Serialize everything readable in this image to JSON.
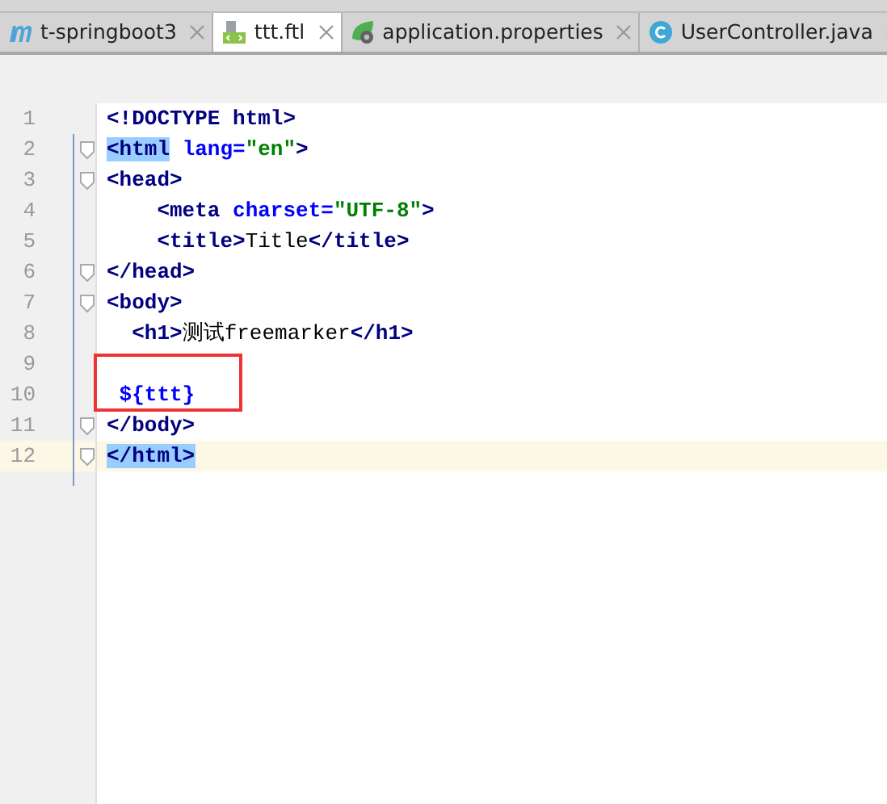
{
  "tabs": [
    {
      "label": "t-springboot3",
      "kind": "maven",
      "selected": false
    },
    {
      "label": "ttt.ftl",
      "kind": "template",
      "selected": true
    },
    {
      "label": "application.properties",
      "kind": "config",
      "selected": false
    },
    {
      "label": "UserController.java",
      "kind": "class",
      "selected": false
    }
  ],
  "editor": {
    "lines": [
      {
        "number": "1",
        "fold": false,
        "current": false,
        "tokens": [
          {
            "kind": "tag",
            "text": "<!DOCTYPE "
          },
          {
            "kind": "keyword",
            "text": "html"
          },
          {
            "kind": "tag",
            "text": ">"
          }
        ]
      },
      {
        "number": "2",
        "fold": true,
        "current": false,
        "tokens": [
          {
            "kind": "tag",
            "text": "<html",
            "matched": true
          },
          {
            "kind": "attr",
            "text": " lang="
          },
          {
            "kind": "str",
            "text": "\"en\""
          },
          {
            "kind": "tag",
            "text": ">"
          }
        ]
      },
      {
        "number": "3",
        "fold": true,
        "current": false,
        "tokens": [
          {
            "kind": "tag",
            "text": "<head>"
          }
        ]
      },
      {
        "number": "4",
        "fold": false,
        "current": false,
        "tokens": [
          {
            "kind": "tag",
            "text": "    <meta "
          },
          {
            "kind": "attr",
            "text": "charset="
          },
          {
            "kind": "str",
            "text": "\"UTF-8\""
          },
          {
            "kind": "tag",
            "text": ">"
          }
        ]
      },
      {
        "number": "5",
        "fold": false,
        "current": false,
        "tokens": [
          {
            "kind": "tag",
            "text": "    <title>"
          },
          {
            "kind": "text",
            "text": "Title"
          },
          {
            "kind": "tag",
            "text": "</title>"
          }
        ]
      },
      {
        "number": "6",
        "fold": true,
        "current": false,
        "tokens": [
          {
            "kind": "tag",
            "text": "</head>"
          }
        ]
      },
      {
        "number": "7",
        "fold": true,
        "current": false,
        "tokens": [
          {
            "kind": "tag",
            "text": "<body>"
          }
        ]
      },
      {
        "number": "8",
        "fold": false,
        "current": false,
        "tokens": [
          {
            "kind": "tag",
            "text": "  <h1>"
          },
          {
            "kind": "text",
            "text": "测试freemarker"
          },
          {
            "kind": "tag",
            "text": "</h1>"
          }
        ]
      },
      {
        "number": "9",
        "fold": false,
        "current": false
      },
      {
        "number": "10",
        "fold": false,
        "current": false,
        "tokens": [
          {
            "kind": "var",
            "text": " ${ttt}"
          }
        ]
      },
      {
        "number": "11",
        "fold": true,
        "current": false,
        "tokens": [
          {
            "kind": "tag",
            "text": "</body>"
          }
        ]
      },
      {
        "number": "12",
        "fold": true,
        "current": true,
        "tokens": [
          {
            "kind": "tag",
            "text": "</html>",
            "matched": true
          }
        ]
      }
    ]
  }
}
